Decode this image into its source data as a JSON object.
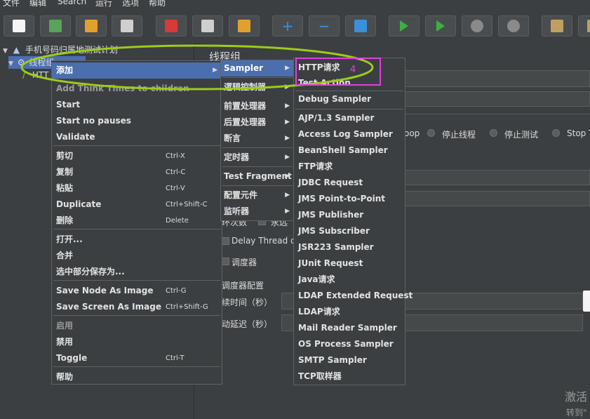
{
  "menubar": {
    "items": [
      "文件",
      "编辑",
      "Search",
      "运行",
      "选项",
      "帮助"
    ]
  },
  "toolbar": {
    "buttons": [
      {
        "name": "new-icon",
        "color": "#f5f5f5"
      },
      {
        "name": "templates-icon",
        "color": "#5aa35a"
      },
      {
        "name": "open-icon",
        "color": "#e0a030"
      },
      {
        "name": "save-icon",
        "color": "#cfcfcf"
      },
      {
        "name": "cut-icon",
        "color": "#d83a3a"
      },
      {
        "name": "copy-icon",
        "color": "#cfcfcf"
      },
      {
        "name": "paste-icon",
        "color": "#e0a030"
      },
      {
        "name": "expand-icon",
        "color": "#3c8fd8"
      },
      {
        "name": "collapse-icon",
        "color": "#3c8fd8"
      },
      {
        "name": "toggle-icon",
        "color": "#3c8fd8"
      },
      {
        "name": "start-icon",
        "color": "#3cb043"
      },
      {
        "name": "start-no-pauses-icon",
        "color": "#3cb043"
      },
      {
        "name": "stop-icon",
        "color": "#8a8a8a"
      },
      {
        "name": "shutdown-icon",
        "color": "#8a8a8a"
      },
      {
        "name": "clear-icon",
        "color": "#c0a060"
      },
      {
        "name": "clear-all-icon",
        "color": "#c0a060"
      }
    ]
  },
  "tree": {
    "test_plan": "手机号码归属地测试计划",
    "thread_group": "线程组",
    "child": "HTT"
  },
  "panel": {
    "title": "线程组",
    "radio_labels": [
      "oop",
      "停止线程",
      "停止测试",
      "Stop T"
    ],
    "loop_label": "环次数",
    "forever_label": "永远",
    "delay_label": "Delay Thread cr",
    "scheduler_label": "调度器",
    "scheduler_config": "调度器配置",
    "duration_label": "续时间（秒）",
    "startup_delay_label": "动延迟（秒）"
  },
  "context_menu": {
    "items": [
      {
        "label": "添加",
        "shortcut": "",
        "submenu": true,
        "selected": true,
        "disabled": false
      },
      {
        "label": "Add Think Times to children",
        "shortcut": "",
        "disabled": true
      },
      {
        "label": "Start",
        "shortcut": "",
        "disabled": false
      },
      {
        "label": "Start no pauses",
        "shortcut": "",
        "disabled": false
      },
      {
        "label": "Validate",
        "shortcut": "",
        "disabled": false
      },
      {
        "label": "剪切",
        "shortcut": "Ctrl-X",
        "disabled": false
      },
      {
        "label": "复制",
        "shortcut": "Ctrl-C",
        "disabled": false
      },
      {
        "label": "粘贴",
        "shortcut": "Ctrl-V",
        "disabled": false
      },
      {
        "label": "Duplicate",
        "shortcut": "Ctrl+Shift-C",
        "disabled": false
      },
      {
        "label": "删除",
        "shortcut": "Delete",
        "disabled": false
      },
      {
        "label": "打开...",
        "shortcut": "",
        "disabled": false
      },
      {
        "label": "合并",
        "shortcut": "",
        "disabled": false
      },
      {
        "label": "选中部分保存为...",
        "shortcut": "",
        "disabled": false
      },
      {
        "label": "Save Node As Image",
        "shortcut": "Ctrl-G",
        "disabled": false
      },
      {
        "label": "Save Screen As Image",
        "shortcut": "Ctrl+Shift-G",
        "disabled": false
      },
      {
        "label": "启用",
        "shortcut": "",
        "disabled": true
      },
      {
        "label": "禁用",
        "shortcut": "",
        "disabled": false
      },
      {
        "label": "Toggle",
        "shortcut": "Ctrl-T",
        "disabled": false
      },
      {
        "label": "帮助",
        "shortcut": "",
        "disabled": false
      }
    ]
  },
  "add_submenu": {
    "items": [
      {
        "label": "Sampler",
        "selected": true
      },
      {
        "label": "逻辑控制器"
      },
      {
        "label": "前置处理器"
      },
      {
        "label": "后置处理器"
      },
      {
        "label": "断言"
      },
      {
        "label": "定时器"
      },
      {
        "label": "Test Fragment"
      },
      {
        "label": "配置元件"
      },
      {
        "label": "监听器"
      }
    ]
  },
  "sampler_submenu": {
    "items": [
      "HTTP请求",
      "Test Action",
      "Debug Sampler",
      "AJP/1.3 Sampler",
      "Access Log Sampler",
      "BeanShell Sampler",
      "FTP请求",
      "JDBC Request",
      "JMS Point-to-Point",
      "JMS Publisher",
      "JMS Subscriber",
      "JSR223 Sampler",
      "JUnit Request",
      "Java请求",
      "LDAP Extended Request",
      "LDAP请求",
      "Mail Reader Sampler",
      "OS Process Sampler",
      "SMTP Sampler",
      "TCP取样器"
    ]
  },
  "annotation": {
    "number": "4",
    "color": "#e040e0",
    "ellipse_color": "#9ccc1a"
  },
  "watermark": {
    "line1": "激活",
    "line2": "转到\""
  }
}
